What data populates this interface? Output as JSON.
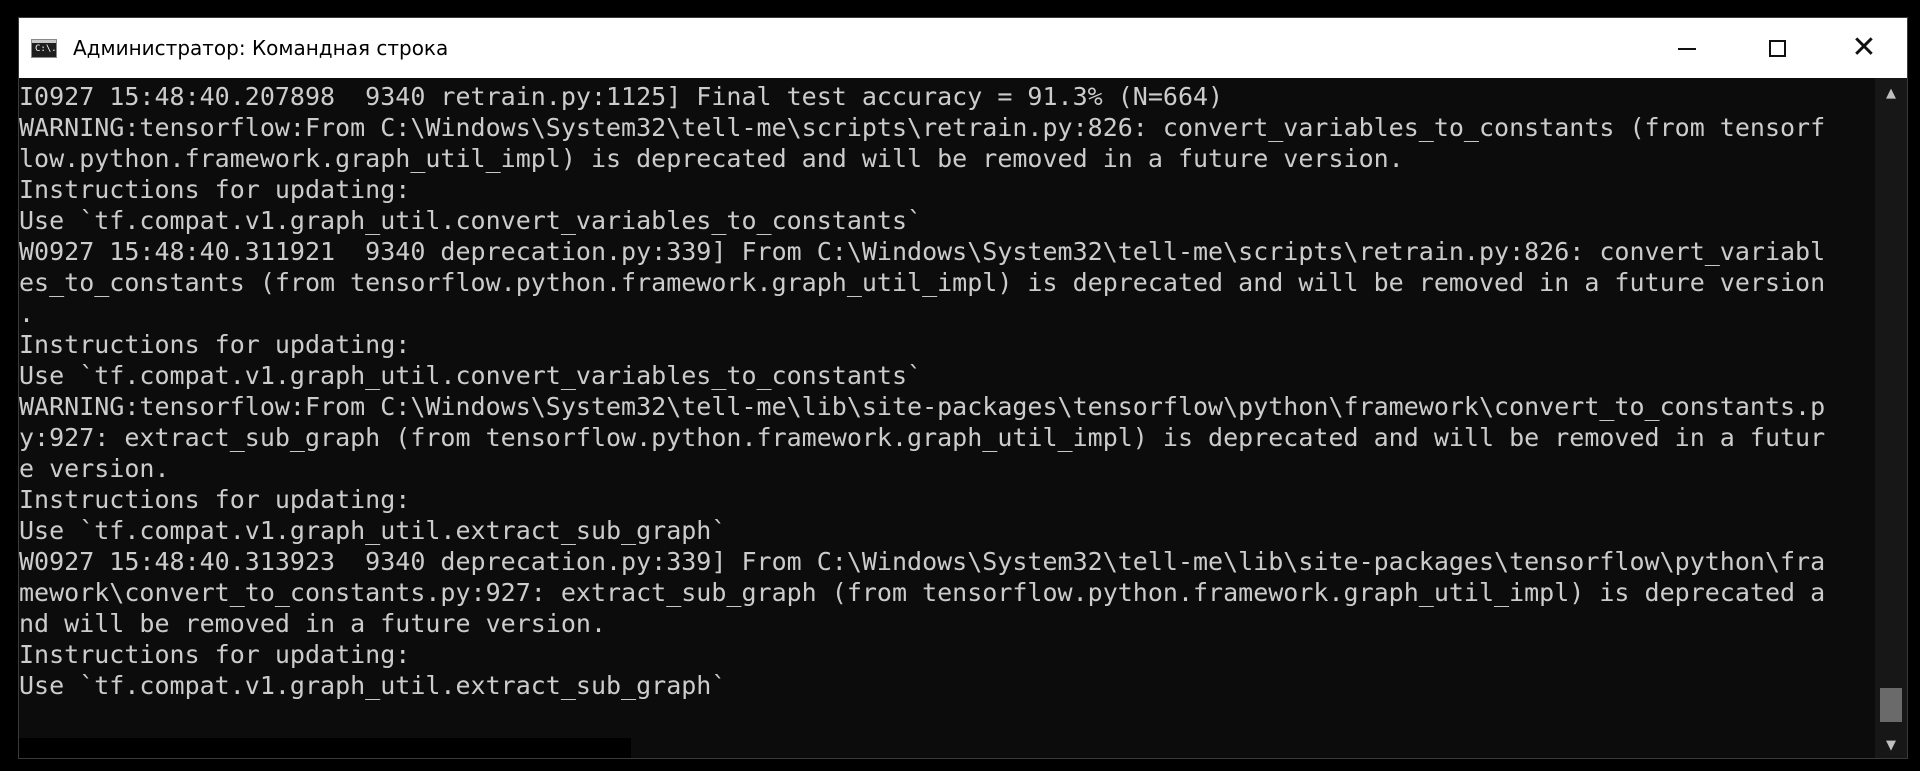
{
  "window": {
    "title": "Администратор: Командная строка",
    "icon_label": "C:\\."
  },
  "titlebar_buttons": {
    "minimize": "minimize-icon",
    "maximize": "maximize-icon",
    "close": "✕"
  },
  "console": {
    "lines": [
      "I0927 15:48:40.207898  9340 retrain.py:1125] Final test accuracy = 91.3% (N=664)",
      "WARNING:tensorflow:From C:\\Windows\\System32\\tell-me\\scripts\\retrain.py:826: convert_variables_to_constants (from tensorf",
      "low.python.framework.graph_util_impl) is deprecated and will be removed in a future version.",
      "Instructions for updating:",
      "Use `tf.compat.v1.graph_util.convert_variables_to_constants`",
      "W0927 15:48:40.311921  9340 deprecation.py:339] From C:\\Windows\\System32\\tell-me\\scripts\\retrain.py:826: convert_variabl",
      "es_to_constants (from tensorflow.python.framework.graph_util_impl) is deprecated and will be removed in a future version",
      ".",
      "Instructions for updating:",
      "Use `tf.compat.v1.graph_util.convert_variables_to_constants`",
      "WARNING:tensorflow:From C:\\Windows\\System32\\tell-me\\lib\\site-packages\\tensorflow\\python\\framework\\convert_to_constants.p",
      "y:927: extract_sub_graph (from tensorflow.python.framework.graph_util_impl) is deprecated and will be removed in a futur",
      "e version.",
      "Instructions for updating:",
      "Use `tf.compat.v1.graph_util.extract_sub_graph`",
      "W0927 15:48:40.313923  9340 deprecation.py:339] From C:\\Windows\\System32\\tell-me\\lib\\site-packages\\tensorflow\\python\\fra",
      "mework\\convert_to_constants.py:927: extract_sub_graph (from tensorflow.python.framework.graph_util_impl) is deprecated a",
      "nd will be removed in a future version.",
      "Instructions for updating:",
      "Use `tf.compat.v1.graph_util.extract_sub_graph`"
    ]
  },
  "scrollbar": {
    "up_arrow": "▲",
    "down_arrow": "▼",
    "position_fraction": 0.95
  }
}
